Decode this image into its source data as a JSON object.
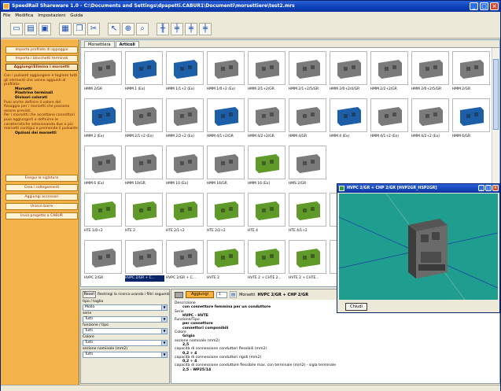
{
  "window": {
    "title": "SpeedRail Shareware  1.0 - C:\\Documents and Settings\\dpapetti.CABUR1\\Documenti\\morsettiere\\test2.mrs"
  },
  "menu": [
    "File",
    "Modifica",
    "Impostazioni",
    "Guida"
  ],
  "toolbar_icons": [
    "new-icon",
    "open-icon",
    "save-icon",
    "print-icon",
    "copy-icon",
    "cut-icon",
    "pointer-icon",
    "add-icon",
    "zoom-icon",
    "layout1-icon",
    "layout2-icon",
    "layout3-icon",
    "layout4-icon"
  ],
  "left_panel": {
    "buttons_top": [
      "Importa profilato di appoggio",
      "Importa i blocchetti terminali",
      "Aggiungi/Elimina i morsetti"
    ],
    "help_lines": [
      "Con i pulsanti aggiungere e togliere tutti gli elementi che vanno aggiunti al profilato:",
      "Morsetti",
      "Piastrine terminali",
      "Divisori colorati",
      "Puoi anche definire il valore del fissaggio per i morsetti che possono essere previsti.",
      "Per i morsetti che accettano connettori puoi aggiungerli e definirne le caratteristiche selezionando due o più morsetti contigui e premendo il pulsante",
      "Opzioni dei morsetti"
    ],
    "buttons_bottom": [
      "Esegui la siglatura",
      "Crea i collegamenti",
      "Aggiungi accessori",
      "Unisce barre",
      "Invia progetto a CABUR"
    ]
  },
  "main": {
    "tabs": [
      "Morsettiera",
      "Articoli"
    ],
    "items": [
      "HMM 2/GR",
      "HMM 1 (Ex)",
      "HMM 1/1+2 (Ex)",
      "HMM 1/0+2 (Ex)",
      "HMM 2/1+2/GR",
      "HMM 2/1+2/5/GR",
      "HMM 2/0+2/4/GR",
      "HMM 2/2+2/GR",
      "HMM 2/0+2/5/GR",
      "HMM 2/GR",
      "HMM 2 (Ex)",
      "HMM 2/1+2 (Ex)",
      "HMM 2/2+2 (Ex)",
      "HMM 4/1+2/GR",
      "HMM 4/2+2/GR",
      "HMM 4/GR",
      "HMM 4 (Ex)",
      "HMM 4/1+2 (Ex)",
      "HMM 4/2+2 (Ex)",
      "HMM 6/GR",
      "HMM 6 (Ex)",
      "HMM 10/GR",
      "HMM 10 (Ex)",
      "HMM 16/GR",
      "HMM 16 (Ex)",
      "HMS 2/GR",
      "",
      "",
      "",
      "",
      "HTE 1/0+2",
      "HTE 2",
      "HTE 2/1+2",
      "HTE 2/2+2",
      "HTE 4",
      "HTE 4/1+2",
      "",
      "",
      "",
      "",
      "HVPC 2/GR",
      "HVPC 2/GR + C...",
      "HVPC 2/GR + C...",
      "HVTE 2",
      "HVTE 2 + CHTE 2...",
      "HVTE 2 + CHTE...",
      "",
      "",
      "",
      ""
    ],
    "selected_label": "HVPC 2/GR + C..."
  },
  "filters": {
    "reset_label": "Reset",
    "hint": "Restringi la ricerca usando i filtri seguenti",
    "fields": [
      {
        "label": "tipo / taglia",
        "value": "Molla"
      },
      {
        "label": "serie",
        "value": "Tutti"
      },
      {
        "label": "funzione / tipo",
        "value": "Tutti"
      },
      {
        "label": "Colore",
        "value": "Tutti"
      },
      {
        "label": "sezione nominale (mm2)",
        "value": "Tutti"
      }
    ]
  },
  "detail": {
    "add_label": "Aggiungi",
    "qty": "1",
    "heading_prefix": "Morsetti",
    "heading_value": "HVPC 2/GR + CHP 2/GR",
    "rows": [
      {
        "label": "Descrizione",
        "value": "con connettore femmina per un conduttore"
      },
      {
        "label": "Serie",
        "value": "HVPC - HVTE"
      },
      {
        "label": "Funzione/Tipo",
        "value": "per connettore"
      },
      {
        "label": "",
        "value": "connettori componibili"
      },
      {
        "label": "Colore",
        "value": "Grigio"
      },
      {
        "label": "sezione nominale (mm2)",
        "value": "2,5"
      },
      {
        "label": "capacità di connessione conduttori flessibili (mm2)",
        "value": "0,2 ÷ 4"
      },
      {
        "label": "capacità di connessione conduttori rigidi (mm2)",
        "value": "0,2 ÷ 4"
      },
      {
        "label": "capacità di connessione conduttore flessibile max. con terminale (mm2) - sigla terminale",
        "value": "2,5 - WP25/14"
      }
    ]
  },
  "viewer": {
    "title": "HVPC 2/GR + CHP 2/GR [HVP2GR_HSP2GR]",
    "close_label": "Chiudi"
  },
  "colors": {
    "left_panel": "#f4b24a",
    "viewer_bg": "#1f9e8f",
    "terminal_blue": "#1d5fa8",
    "terminal_green": "#5f9a2a",
    "terminal_grey": "#7b7b7b"
  }
}
